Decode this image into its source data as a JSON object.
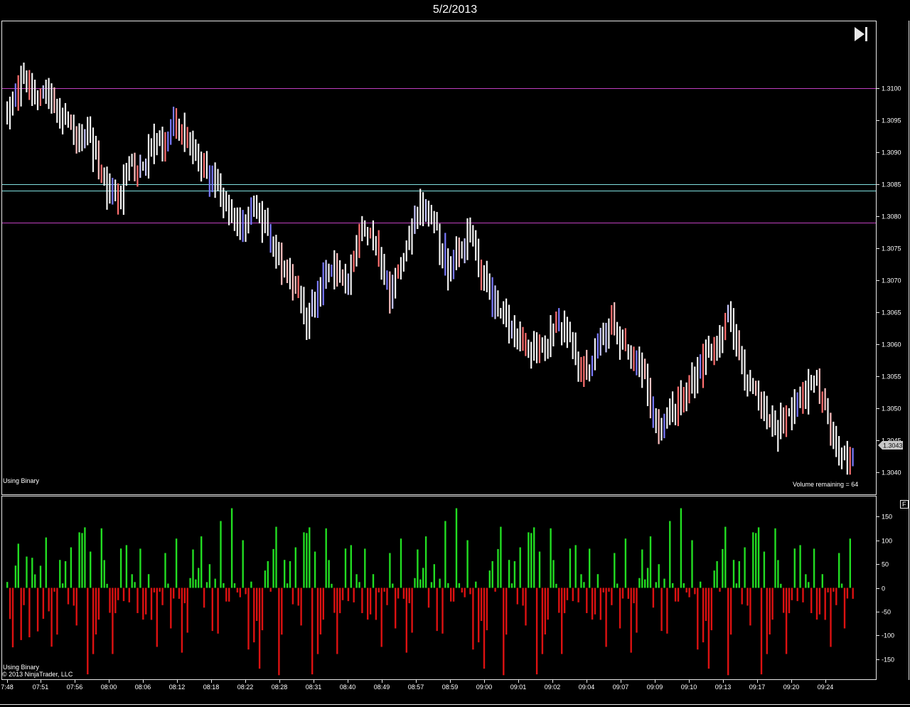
{
  "header": {
    "title": "5/2/2013"
  },
  "price_panel": {
    "indicator_label": "Using Binary",
    "status_text": "Volume remaining = 64",
    "last_price_label": "1.3043",
    "skip_icon": "skip-to-end-icon"
  },
  "volume_panel": {
    "indicator_label": "Using Binary",
    "copyright": "© 2013 NinjaTrader, LLC",
    "button_label": "F"
  },
  "colors": {
    "up": "#7a7aff",
    "down": "#ff7070",
    "neutral": "#f2f2f2",
    "magenta_line": "#c040c0",
    "cyan_line": "#80e0e0",
    "volume_up": "#22dd22",
    "volume_down": "#dd1111"
  },
  "chart_data": [
    {
      "type": "candlestick",
      "name": "",
      "y_ticks": [
        "1.3100",
        "1.3095",
        "1.3090",
        "1.3085",
        "1.3080",
        "1.3075",
        "1.3070",
        "1.3065",
        "1.3060",
        "1.3055",
        "1.3050",
        "1.3045",
        "1.3040"
      ],
      "ylim": [
        1.30365,
        1.31105
      ],
      "horizontal_lines": [
        {
          "value": 1.31,
          "color": "magenta"
        },
        {
          "value": 1.3085,
          "color": "cyan"
        },
        {
          "value": 1.3084,
          "color": "cyan"
        },
        {
          "value": 1.3079,
          "color": "magenta"
        }
      ],
      "close_waypoints": [
        [
          0,
          1.3095
        ],
        [
          3,
          1.3099
        ],
        [
          6,
          1.3101
        ],
        [
          8,
          1.3101
        ],
        [
          12,
          1.3098
        ],
        [
          15,
          1.3099
        ],
        [
          18,
          1.3096
        ],
        [
          20,
          1.3096
        ],
        [
          25,
          1.3092
        ],
        [
          29,
          1.3093
        ],
        [
          33,
          1.3088
        ],
        [
          36,
          1.3084
        ],
        [
          40,
          1.3082
        ],
        [
          44,
          1.3088
        ],
        [
          48,
          1.3087
        ],
        [
          53,
          1.3092
        ],
        [
          56,
          1.309
        ],
        [
          60,
          1.3095
        ],
        [
          64,
          1.3092
        ],
        [
          68,
          1.309
        ],
        [
          72,
          1.3087
        ],
        [
          75,
          1.3084
        ],
        [
          79,
          1.3082
        ],
        [
          83,
          1.3078
        ],
        [
          87,
          1.308
        ],
        [
          90,
          1.3081
        ],
        [
          94,
          1.3077
        ],
        [
          98,
          1.3074
        ],
        [
          102,
          1.307
        ],
        [
          106,
          1.3066
        ],
        [
          108,
          1.3063
        ],
        [
          110,
          1.3066
        ],
        [
          114,
          1.307
        ],
        [
          118,
          1.3072
        ],
        [
          122,
          1.3069
        ],
        [
          126,
          1.3075
        ],
        [
          128,
          1.3079
        ],
        [
          131,
          1.3077
        ],
        [
          135,
          1.3072
        ],
        [
          138,
          1.3067
        ],
        [
          141,
          1.3072
        ],
        [
          145,
          1.3077
        ],
        [
          149,
          1.3081
        ],
        [
          152,
          1.308
        ],
        [
          155,
          1.3077
        ],
        [
          159,
          1.3071
        ],
        [
          163,
          1.3075
        ],
        [
          167,
          1.3077
        ],
        [
          170,
          1.3072
        ],
        [
          174,
          1.3068
        ],
        [
          178,
          1.3065
        ],
        [
          182,
          1.3062
        ],
        [
          186,
          1.306
        ],
        [
          190,
          1.3059
        ],
        [
          194,
          1.306
        ],
        [
          198,
          1.3064
        ],
        [
          202,
          1.3062
        ],
        [
          206,
          1.3057
        ],
        [
          210,
          1.3056
        ],
        [
          214,
          1.3061
        ],
        [
          218,
          1.3063
        ],
        [
          222,
          1.306
        ],
        [
          226,
          1.3057
        ],
        [
          230,
          1.3055
        ],
        [
          233,
          1.3049
        ],
        [
          235,
          1.3047
        ],
        [
          238,
          1.3049
        ],
        [
          242,
          1.3051
        ],
        [
          246,
          1.3054
        ],
        [
          250,
          1.3056
        ],
        [
          254,
          1.3059
        ],
        [
          258,
          1.3062
        ],
        [
          260,
          1.3064
        ],
        [
          263,
          1.306
        ],
        [
          266,
          1.3055
        ],
        [
          270,
          1.3052
        ],
        [
          274,
          1.3049
        ],
        [
          277,
          1.3046
        ],
        [
          281,
          1.3049
        ],
        [
          285,
          1.305
        ],
        [
          289,
          1.3053
        ],
        [
          292,
          1.3054
        ],
        [
          295,
          1.305
        ],
        [
          298,
          1.3045
        ],
        [
          301,
          1.3042
        ],
        [
          303,
          1.3041
        ],
        [
          305,
          1.3043
        ]
      ]
    },
    {
      "type": "bar",
      "name": "",
      "y_ticks": [
        "150",
        "100",
        "50",
        "0",
        "-50",
        "-100",
        "-150"
      ],
      "ylim": [
        -192,
        192
      ],
      "x_tick_labels": [
        "7:48",
        "07:51",
        "07:56",
        "08:00",
        "08:06",
        "08:12",
        "08:18",
        "08:22",
        "08:28",
        "08:31",
        "08:40",
        "08:49",
        "08:57",
        "08:59",
        "09:00",
        "09:01",
        "09:02",
        "09:04",
        "09:07",
        "09:09",
        "09:10",
        "09:13",
        "09:17",
        "09:20",
        "09:24"
      ],
      "volume_range": [
        -185,
        190
      ]
    }
  ]
}
